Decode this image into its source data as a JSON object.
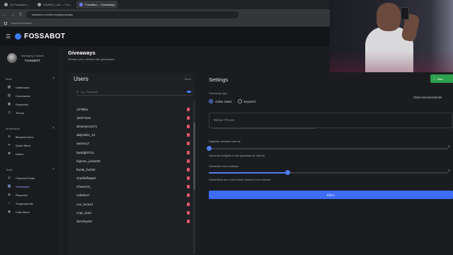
{
  "browser": {
    "tabs": [
      {
        "label": "(2) Fossabot | ...",
        "active": false
      },
      {
        "label": "GiveBot | Live — Fos...",
        "active": false
      },
      {
        "label": "Fossabot — Giveaways",
        "active": true
      }
    ],
    "url": "fossabot.com/dummy/giveaways",
    "bookmarks": [
      "Import bookmarks..."
    ]
  },
  "topbar": {
    "logo": "FOSSABOT"
  },
  "profile": {
    "role": "Managing Channel",
    "name": "FossaBOT"
  },
  "sidebar": {
    "sections": [
      {
        "title": "Main",
        "items": [
          {
            "label": "Dashboard",
            "icon": "dashboard-icon"
          },
          {
            "label": "Commands",
            "icon": "commands-icon"
          },
          {
            "label": "Keywords",
            "icon": "keywords-icon"
          },
          {
            "label": "Timers",
            "icon": "timers-icon"
          }
        ]
      },
      {
        "title": "Moderation",
        "items": [
          {
            "label": "Blocked terms",
            "icon": "block-icon"
          },
          {
            "label": "Spam filters",
            "icon": "filter-icon"
          },
          {
            "label": "Nukes",
            "icon": "nuke-icon"
          }
        ]
      },
      {
        "title": "Tools",
        "items": [
          {
            "label": "Channel Points",
            "icon": "points-icon"
          },
          {
            "label": "Giveaways",
            "icon": "gift-icon",
            "active": true
          },
          {
            "label": "Requests",
            "icon": "requests-icon"
          },
          {
            "label": "Songrequests",
            "icon": "music-icon"
          },
          {
            "label": "Chat Alerts",
            "icon": "alert-icon"
          }
        ]
      }
    ]
  },
  "page": {
    "title": "Giveaways",
    "subtitle": "Reward your viewers with giveaways."
  },
  "users": {
    "title": "Users",
    "clear_label": "Clear",
    "search_placeholder": "e.g. Fossabot",
    "list": [
      "1376lbs",
      "1537mom",
      "dreamycron71",
      "abijmidre_13",
      "aazscry7",
      "bastlight712",
      "bigmac_juniorb5",
      "burak_furitati",
      "charlieflopper",
      "ChaosV2_",
      "cobiduo7",
      "coo_luca12",
      "cnpr_marc",
      "dorichycter"
    ]
  },
  "settings": {
    "title": "Settings",
    "button_label": "Start",
    "type_label": "Giveaway type",
    "radio_active": "Active Users",
    "radio_keyword": "Keyword",
    "chat_announcements": "Chat Announcements",
    "phrase_placeholder": "Winner Phrase",
    "slider1_label": "Eligibility minimum interval",
    "slider1_value": 0,
    "slider1_max": "0",
    "slider1_help": "Users are ineligible to win giveaway for interval",
    "slider2_label": "Subscriber luck multiplier",
    "slider2_value": 0.33,
    "slider2_max": "3",
    "slider2_help": "Subscribers are a more likely chance to be a winner.",
    "roll_label": "ROLL"
  },
  "accent": "#3d7cff",
  "delete_color": "#e0566c",
  "success_color": "#2da04d"
}
